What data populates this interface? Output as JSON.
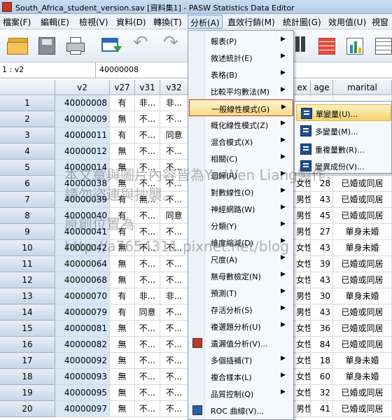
{
  "window": {
    "title": "South_Africa_student_version.sav [資料集1] - PASW Statistics Data Editor"
  },
  "menubar": [
    "檔案(F)",
    "編輯(E)",
    "檢視(V)",
    "資料(D)",
    "轉換(T)",
    "分析(A)",
    "直效行銷(M)",
    "統計圖(G)",
    "效用值(U)",
    "視窗"
  ],
  "toolbar": {
    "icons": [
      "open-folder-icon",
      "save-icon",
      "print-icon",
      "variable-view-icon",
      "undo-icon",
      "redo-icon",
      "pie-chart-icon",
      "binoculars-icon",
      "value-labels-icon",
      "chart-icon",
      "table-icon"
    ]
  },
  "cellbar": {
    "ref": "1 : v2",
    "value": "40000008"
  },
  "grid": {
    "columns": [
      "v2",
      "v27",
      "v31",
      "v32"
    ],
    "right_columns": [
      "ex",
      "age",
      "marital"
    ],
    "rows": [
      {
        "id": "1",
        "v2": "40000008",
        "v27": "有",
        "v31": "非...",
        "v32": "非...",
        "ex": "",
        "age": "",
        "marital": ""
      },
      {
        "id": "2",
        "v2": "40000009",
        "v27": "無",
        "v31": "不...",
        "v32": "不...",
        "ex": "",
        "age": "",
        "marital": ""
      },
      {
        "id": "3",
        "v2": "40000011",
        "v27": "有",
        "v31": "不...",
        "v32": "同意",
        "ex": "",
        "age": "",
        "marital": ""
      },
      {
        "id": "4",
        "v2": "40000012",
        "v27": "無",
        "v31": "不...",
        "v32": "不...",
        "ex": "",
        "age": "",
        "marital": ""
      },
      {
        "id": "5",
        "v2": "40000014",
        "v27": "無",
        "v31": "不...",
        "v32": "不...",
        "ex": "",
        "age": "",
        "marital": ""
      },
      {
        "id": "6",
        "v2": "40000038",
        "v27": "無",
        "v31": "不...",
        "v32": "不...",
        "ex": "女性",
        "age": "28",
        "marital": "已婚或同居"
      },
      {
        "id": "7",
        "v2": "40000039",
        "v27": "有",
        "v31": "無...",
        "v32": "不...",
        "ex": "男性",
        "age": "43",
        "marital": "已婚或同居"
      },
      {
        "id": "8",
        "v2": "40000040",
        "v27": "有",
        "v31": "不...",
        "v32": "同意",
        "ex": "男性",
        "age": "45",
        "marital": "已婚或同居"
      },
      {
        "id": "9",
        "v2": "40000041",
        "v27": "有",
        "v31": "不...",
        "v32": "不...",
        "ex": "男性",
        "age": "27",
        "marital": "單身未婚"
      },
      {
        "id": "10",
        "v2": "40000042",
        "v27": "無",
        "v31": "不...",
        "v32": "不...",
        "ex": "女性",
        "age": "43",
        "marital": "單身未婚"
      },
      {
        "id": "11",
        "v2": "40000064",
        "v27": "無",
        "v31": "不...",
        "v32": "不...",
        "ex": "女性",
        "age": "39",
        "marital": "已婚或同居"
      },
      {
        "id": "12",
        "v2": "40000068",
        "v27": "無",
        "v31": "不...",
        "v32": "不...",
        "ex": "女性",
        "age": "43",
        "marital": "已婚或同居"
      },
      {
        "id": "13",
        "v2": "40000070",
        "v27": "有",
        "v31": "非...",
        "v32": "非...",
        "ex": "男性",
        "age": "30",
        "marital": "單身未婚"
      },
      {
        "id": "14",
        "v2": "40000079",
        "v27": "有",
        "v31": "同意",
        "v32": "不...",
        "ex": "男性",
        "age": "43",
        "marital": "已婚或同居"
      },
      {
        "id": "15",
        "v2": "40000081",
        "v27": "無",
        "v31": "不...",
        "v32": "不...",
        "ex": "女性",
        "age": "36",
        "marital": "已婚或同居"
      },
      {
        "id": "16",
        "v2": "40000082",
        "v27": "無",
        "v31": "不...",
        "v32": "不...",
        "ex": "女性",
        "age": "84",
        "marital": "已婚或同居"
      },
      {
        "id": "17",
        "v2": "40000092",
        "v27": "無",
        "v31": "不...",
        "v32": "不...",
        "ex": "女性",
        "age": "18",
        "marital": "單身未婚"
      },
      {
        "id": "18",
        "v2": "40000093",
        "v27": "無",
        "v31": "不...",
        "v32": "不...",
        "ex": "女性",
        "age": "60",
        "marital": "單身未婚"
      },
      {
        "id": "19",
        "v2": "40000095",
        "v27": "無",
        "v31": "不...",
        "v32": "不...",
        "ex": "女性",
        "age": "32",
        "marital": "已婚或同居"
      },
      {
        "id": "20",
        "v2": "40000097",
        "v27": "無",
        "v31": "不...",
        "v32": "不...",
        "ex": "男性",
        "age": "41",
        "marital": "已婚或同居"
      }
    ]
  },
  "analyze_menu": {
    "items": [
      {
        "label": "報表(P)",
        "submenu": true
      },
      {
        "label": "敘述統計(E)",
        "submenu": true
      },
      {
        "label": "表格(B)",
        "submenu": true
      },
      {
        "label": "比較平均數法(M)",
        "submenu": true
      },
      {
        "label": "一般線性模式(G)",
        "submenu": true,
        "highlighted": true
      },
      {
        "label": "概化線性模式(Z)",
        "submenu": true
      },
      {
        "label": "混合模式(X)",
        "submenu": true
      },
      {
        "label": "相關(C)",
        "submenu": true
      },
      {
        "label": "迴歸(R)",
        "submenu": true
      },
      {
        "label": "對數線性(O)",
        "submenu": true
      },
      {
        "label": "神經網路(W)",
        "submenu": true
      },
      {
        "label": "分類(Y)",
        "submenu": true
      },
      {
        "label": "維度縮減(D)",
        "submenu": true
      },
      {
        "label": "尺度(A)",
        "submenu": true
      },
      {
        "label": "無母數檢定(N)",
        "submenu": true
      },
      {
        "label": "預測(T)",
        "submenu": true
      },
      {
        "label": "存活分析(S)",
        "submenu": true
      },
      {
        "label": "複選題分析(U)",
        "submenu": true
      },
      {
        "label": "遺漏值分析(V)...",
        "submenu": false,
        "icon": true
      },
      {
        "label": "多個插補(T)",
        "submenu": true
      },
      {
        "label": "複合樣本(L)",
        "submenu": true
      },
      {
        "label": "品質控制(Q)",
        "submenu": true
      },
      {
        "label": "ROC 曲線(V)...",
        "submenu": false,
        "icon": true
      }
    ]
  },
  "glm_submenu": {
    "items": [
      {
        "label": "單變量(U)...",
        "highlighted": true
      },
      {
        "label": "多變量(M)..."
      },
      {
        "label": "重複量數(R)..."
      },
      {
        "label": "變異成份(V)..."
      }
    ]
  },
  "watermark": {
    "line1": "本文章與圖片內容皆為Yo-Wen Liang製作，",
    "line2": "請勿盜連與抄襲。",
    "line3": "原創位置為",
    "line4": "http://a7654311.pixnet.net/blog"
  },
  "colors": {
    "accent": "#f7dd86",
    "highlight_border": "#c0392b",
    "row_header": "#c8d6e8",
    "menu_bg": "#f6f8fb"
  }
}
